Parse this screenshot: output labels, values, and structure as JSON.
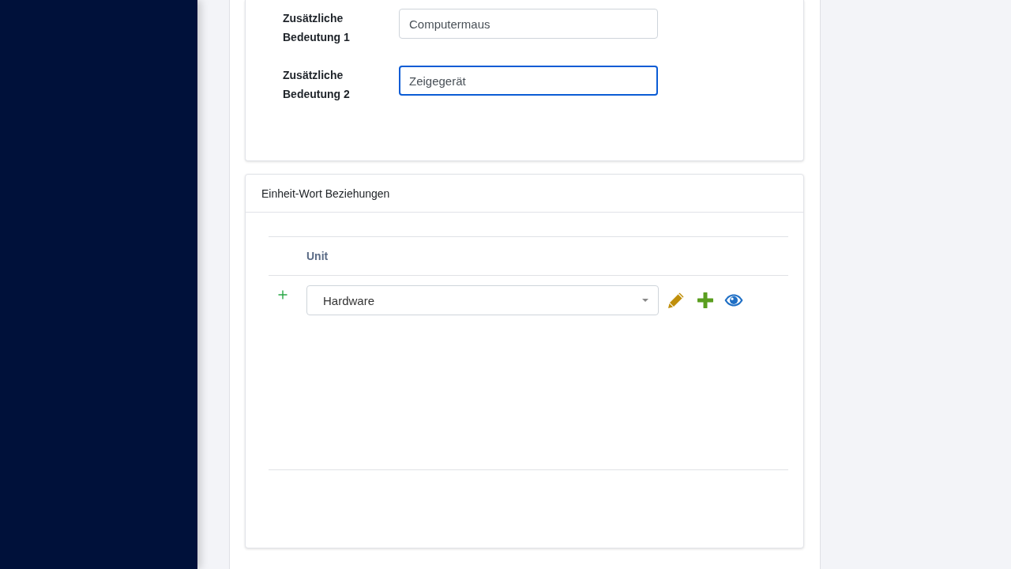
{
  "form_card": {
    "fields": [
      {
        "label": "Zusätzliche Bedeutung 1",
        "value": "Computermaus",
        "focused": false
      },
      {
        "label": "Zusätzliche Bedeutung 2",
        "value": "Zeigegerät",
        "focused": true
      }
    ]
  },
  "relations_card": {
    "title": "Einheit-Wort Beziehungen",
    "table": {
      "columns": [
        "Unit"
      ],
      "rows": [
        {
          "unit": "Hardware"
        }
      ]
    }
  }
}
